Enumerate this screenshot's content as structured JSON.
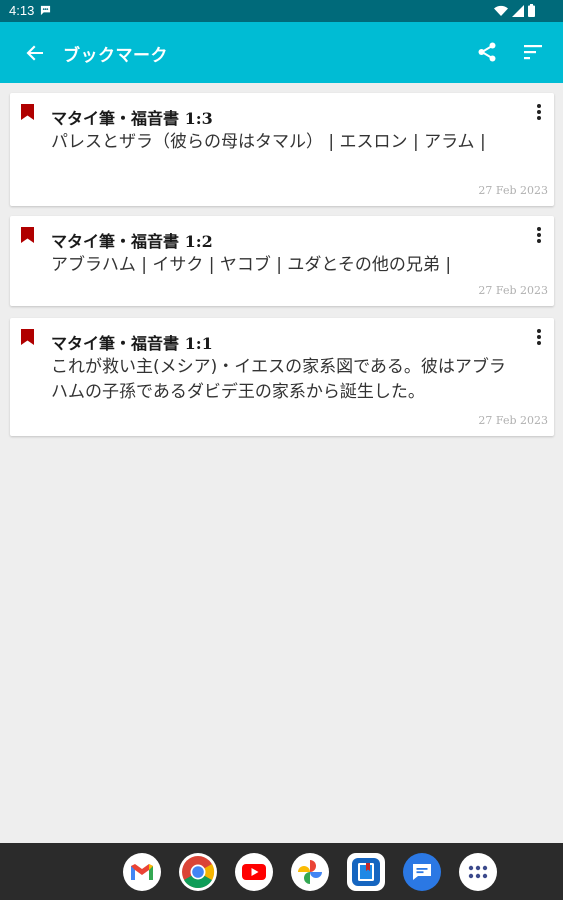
{
  "status_bar": {
    "time": "4:13",
    "icons": [
      "message-icon",
      "wifi-icon",
      "signal-icon",
      "battery-icon"
    ]
  },
  "app_bar": {
    "title": "ブックマーク",
    "icons": [
      "back-arrow-icon",
      "share-icon",
      "sort-icon"
    ]
  },
  "bookmarks": [
    {
      "title": "マタイ筆・福音書 1:3",
      "text": "パレスとザラ（彼らの母はタマル） | エスロン | アラム |",
      "date": "27 Feb 2023"
    },
    {
      "title": "マタイ筆・福音書 1:2",
      "text": "アブラハム | イサク | ヤコブ | ユダとその他の兄弟 |",
      "date": "27 Feb 2023"
    },
    {
      "title": "マタイ筆・福音書 1:1",
      "text": "これが救い主(メシア)・イエスの家系図である。彼はアブラハムの子孫であるダビデ王の家系から誕生した。",
      "date": "27 Feb 2023"
    }
  ],
  "colors": {
    "status_bar": "#006a7a",
    "app_bar": "#00bcd4",
    "bookmark_marker": "#b00000",
    "background": "#eeeeee",
    "dock": "#2b2b2b"
  },
  "dock_apps": [
    "gmail-icon",
    "chrome-icon",
    "youtube-icon",
    "photos-icon",
    "bible-app-icon",
    "messages-icon",
    "app-drawer-icon"
  ]
}
